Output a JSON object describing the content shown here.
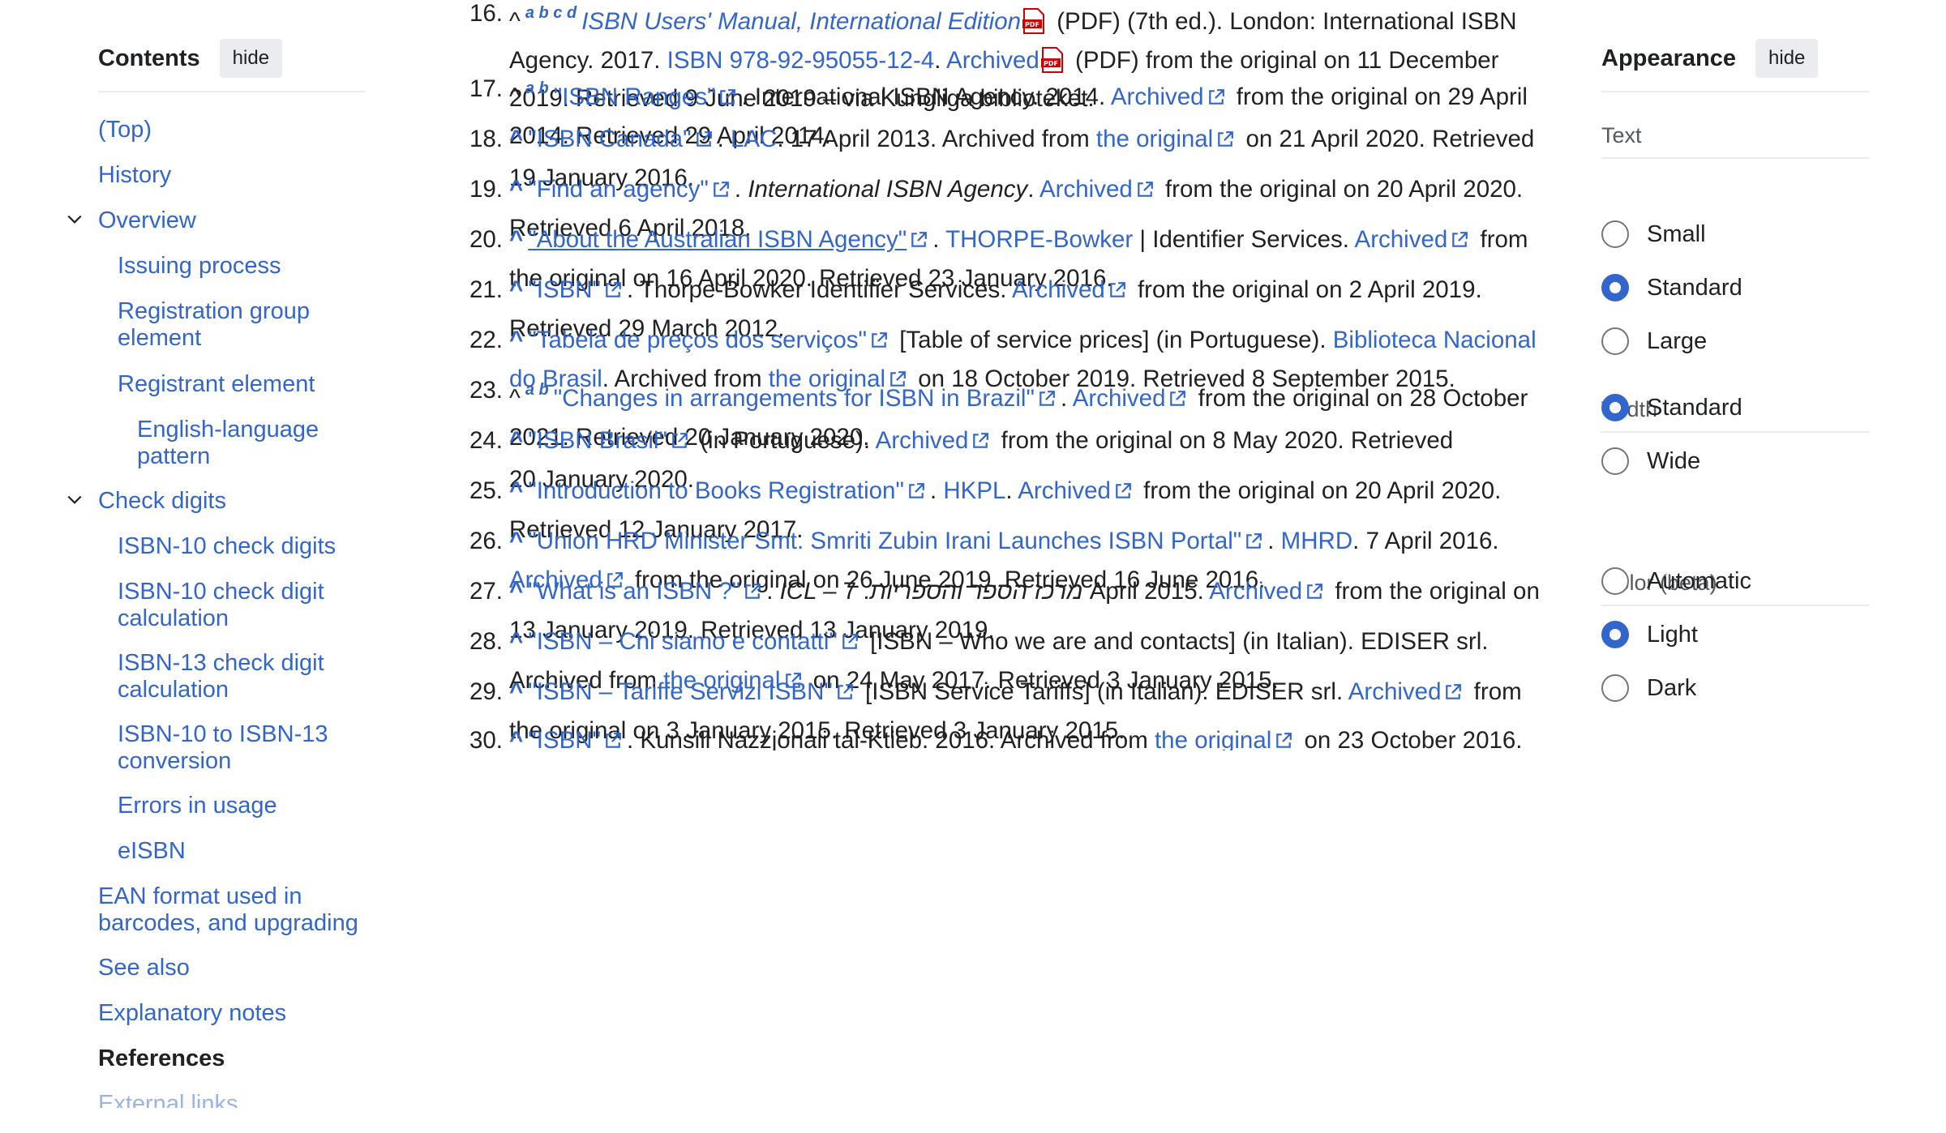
{
  "toc": {
    "title": "Contents",
    "hide_label": "hide",
    "items": [
      {
        "label": "(Top)"
      },
      {
        "label": "History"
      },
      {
        "label": "Overview"
      },
      {
        "label": "Issuing process"
      },
      {
        "label": "Registration group element"
      },
      {
        "label": "Registrant element"
      },
      {
        "label": "English-language pattern"
      },
      {
        "label": "Check digits"
      },
      {
        "label": "ISBN-10 check digits"
      },
      {
        "label": "ISBN-10 check digit calculation"
      },
      {
        "label": "ISBN-13 check digit calculation"
      },
      {
        "label": "ISBN-10 to ISBN-13 conversion"
      },
      {
        "label": "Errors in usage"
      },
      {
        "label": "eISBN"
      },
      {
        "label": "EAN format used in barcodes, and upgrading"
      },
      {
        "label": "See also"
      },
      {
        "label": "Explanatory notes"
      },
      {
        "label": "References"
      },
      {
        "label": "External links"
      }
    ]
  },
  "refs": {
    "r16": {
      "num": "16.",
      "caret": "^",
      "sup": "a b c d",
      "title": "ISBN Users' Manual, International Edition",
      "t1": " (PDF) (7th ed.). London: International ISBN",
      "t2": "Agency. 2017. ",
      "isbn": "ISBN 978-92-95055-12-4",
      "dot": ". ",
      "archived": "Archived",
      "t3": " (PDF) from the original on 11 December",
      "t4": "2019. Retrieved 9 June 2019 – via Kungliga biblioteket."
    },
    "r17": {
      "num": "17.",
      "caret": "^",
      "sup": "a b",
      "title": "\"ISBN Ranges\"",
      "t1": ". International ISBN Agency. 2014. ",
      "archived": "Archived",
      "t2": " from the original on 29 April",
      "t3": "2014. Retrieved 29 April 2014."
    },
    "r18": {
      "num": "18.",
      "caret": "^",
      "title": "\"ISBN Canada\"",
      "dot": ". ",
      "pub": "LAC",
      "t1": ". 17 April 2013. Archived from ",
      "orig": "the original",
      "t2": " on 21 April 2020. Retrieved",
      "t3": "19 January 2016."
    },
    "r19": {
      "num": "19.",
      "caret": "^",
      "title": "\"Find an agency\"",
      "dot": ". ",
      "pub": "International ISBN Agency",
      "t1": ". ",
      "archived": "Archived",
      "t2": " from the original on 20 April 2020.",
      "t3": "Retrieved 6 April 2018."
    },
    "r20": {
      "num": "20.",
      "caret": "^",
      "title": "\"About the Australian ISBN Agency\"",
      "dot": ". ",
      "pub": "THORPE-Bowker",
      "t1": " | Identifier Services. ",
      "archived": "Archived",
      "t2": " from",
      "t3": "the original on 16 April 2020. Retrieved 23 January 2016."
    },
    "r21": {
      "num": "21.",
      "caret": "^",
      "title": "\"ISBN\"",
      "t1": ". Thorpe-Bowker Identifier Services. ",
      "archived": "Archived",
      "t2": " from the original on 2 April 2019.",
      "t3": "Retrieved 29 March 2012."
    },
    "r22": {
      "num": "22.",
      "caret": "^",
      "title": "\"Tabela de preços dos serviços\"",
      "t1": " [Table of service prices] (in Portuguese). ",
      "pub_a": "Biblioteca Nacional",
      "pub_b": "do Brasil",
      "t2": ". Archived from ",
      "orig": "the original",
      "t3": " on 18 October 2019. Retrieved 8 September 2015."
    },
    "r23": {
      "num": "23.",
      "caret": "^",
      "sup": "a b",
      "title": "\"Changes in arrangements for ISBN in Brazil\"",
      "dot": ". ",
      "archived": "Archived",
      "t1": " from the original on 28 October",
      "t2": "2021. Retrieved 20 January 2020."
    },
    "r24": {
      "num": "24.",
      "caret": "^",
      "title": "\"ISBN Brasil\"",
      "t1": " (in Portuguese). ",
      "archived": "Archived",
      "t2": " from the original on 8 May 2020. Retrieved",
      "t3": "20 January 2020."
    },
    "r25": {
      "num": "25.",
      "caret": "^",
      "title": "\"Introduction to Books Registration\"",
      "dot": ". ",
      "pub": "HKPL",
      "dot2": ". ",
      "archived": "Archived",
      "t1": " from the original on 20 April 2020.",
      "t2": "Retrieved 12 January 2017."
    },
    "r26": {
      "num": "26.",
      "caret": "^",
      "title": "\"Union HRD Minister Smt. Smriti Zubin Irani Launches ISBN Portal\"",
      "dot": ". ",
      "pub": "MHRD",
      "t1": ". 7 April 2016.",
      "archived": "Archived",
      "t2": " from the original on 26 June 2019. Retrieved 16 June 2016."
    },
    "r27": {
      "num": "27.",
      "caret": "^",
      "title": "\"What is an ISBN ?\"",
      "t1": ". ",
      "pub": "ICL – מרכז הספר והספריות",
      "t2": ". 7 April 2015. ",
      "archived": "Archived",
      "t3": " from the original on",
      "t4": "13 January 2019. Retrieved 13 January 2019."
    },
    "r28": {
      "num": "28.",
      "caret": "^",
      "title": "\"ISBN – Chi siamo e contatti\"",
      "t1": " [ISBN – Who we are and contacts] (in Italian). EDISER srl.",
      "t2": "Archived from ",
      "orig": "the original",
      "t3": " on 24 May 2017. Retrieved 3 January 2015."
    },
    "r29": {
      "num": "29.",
      "caret": "^",
      "title": "\"ISBN – Tariffe Servizi ISBN\"",
      "t1": " [ISBN Service Tariffs] (in Italian). EDISER srl. ",
      "archived": "Archived",
      "t2": " from",
      "t3": "the original on 3 January 2015. Retrieved 3 January 2015."
    },
    "r30": {
      "num": "30.",
      "caret": "^",
      "title": "\"ISBN\"",
      "t1": ". Kunsill Nazzjonali tal-Ktieb. 2016. Archived from ",
      "orig": "the original",
      "t2": " on 23 October 2016."
    }
  },
  "appearance": {
    "title": "Appearance",
    "hide_label": "hide",
    "text_label": "Text",
    "text_options": [
      "Small",
      "Standard",
      "Large"
    ],
    "text_selected": "Standard",
    "width_label": "Width",
    "width_options": [
      "Standard",
      "Wide"
    ],
    "width_selected": "Standard",
    "color_label": "Color (beta)",
    "color_options": [
      "Automatic",
      "Light",
      "Dark"
    ],
    "color_selected": "Light"
  },
  "colors": {
    "link": "#3366cc",
    "text": "#202122",
    "accent": "#3366cc"
  }
}
